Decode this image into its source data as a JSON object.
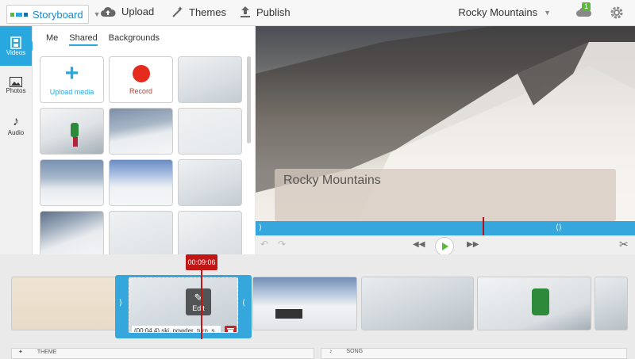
{
  "header": {
    "app_name": "Storyboard",
    "upload_label": "Upload",
    "themes_label": "Themes",
    "publish_label": "Publish",
    "project_name": "Rocky Mountains",
    "notification_count": "1"
  },
  "rail": {
    "items": [
      {
        "label": "Videos",
        "icon": "film-icon"
      },
      {
        "label": "Photos",
        "icon": "image-icon"
      },
      {
        "label": "Audio",
        "icon": "music-note-icon"
      }
    ]
  },
  "library": {
    "tabs": [
      "Me",
      "Shared",
      "Backgrounds"
    ],
    "active_tab": "Shared",
    "upload_label": "Upload media",
    "record_label": "Record"
  },
  "preview": {
    "title_text": "Rocky Mountains"
  },
  "timeline": {
    "timecode": "00:09:06",
    "selected_clip_label": "(00:04.4) ski_powder_turn_s...",
    "edit_label": "Edit",
    "theme_label": "THEME",
    "song_label": "SONG"
  },
  "colors": {
    "accent": "#29a8e0",
    "playhead": "#c01616",
    "play": "#5ab93b",
    "record": "#e52c1c"
  }
}
